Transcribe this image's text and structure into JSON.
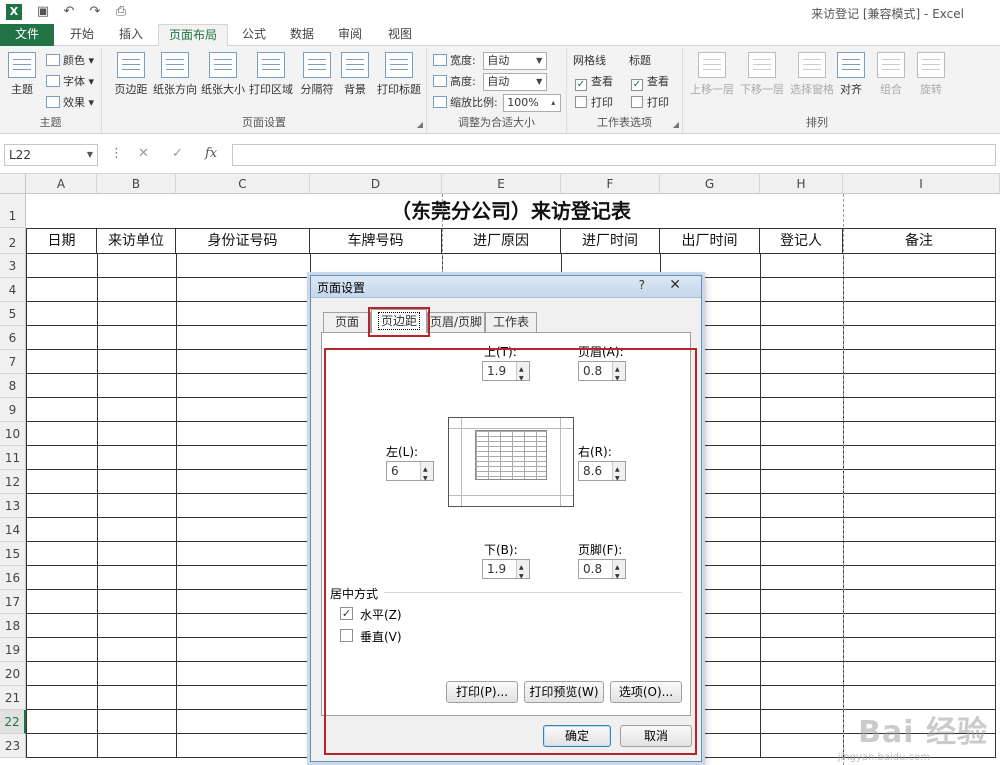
{
  "window": {
    "title": "来访登记 [兼容模式] - Excel",
    "app_icon": "X"
  },
  "qat_icons": [
    "save-icon",
    "undo-icon",
    "redo-icon",
    "print-preview-icon"
  ],
  "ribbon": {
    "tabs": [
      {
        "label": "文件",
        "kind": "file"
      },
      {
        "label": "开始"
      },
      {
        "label": "插入"
      },
      {
        "label": "页面布局",
        "kind": "active"
      },
      {
        "label": "公式"
      },
      {
        "label": "数据"
      },
      {
        "label": "审阅"
      },
      {
        "label": "视图"
      }
    ],
    "theme_group": {
      "big_label": "主题",
      "items": [
        "颜色",
        "字体",
        "效果"
      ],
      "label": "主题"
    },
    "page_setup_group": {
      "buttons": [
        "页边距",
        "纸张方向",
        "纸张大小",
        "打印区域",
        "分隔符",
        "背景",
        "打印标题"
      ],
      "label": "页面设置"
    },
    "scale_group": {
      "width_label": "宽度:",
      "width_value": "自动",
      "height_label": "高度:",
      "height_value": "自动",
      "scale_label": "缩放比例:",
      "scale_value": "100%",
      "label": "调整为合适大小"
    },
    "sheet_options_group": {
      "gridlines": "网格线",
      "headings": "标题",
      "view": "查看",
      "print": "打印",
      "label": "工作表选项"
    },
    "arrange_group": {
      "buttons": [
        "上移一层",
        "下移一层",
        "选择窗格",
        "对齐",
        "组合",
        "旋转"
      ],
      "label": "排列"
    }
  },
  "formula_bar": {
    "name_box": "L22",
    "cancel": "✕",
    "enter": "✓",
    "fx": "fx",
    "value": ""
  },
  "sheet": {
    "columns": [
      "A",
      "B",
      "C",
      "D",
      "E",
      "F",
      "G",
      "H",
      "I"
    ],
    "rows": [
      "1",
      "2",
      "3",
      "4",
      "5",
      "6",
      "7",
      "8",
      "9",
      "10",
      "11",
      "12",
      "13",
      "14",
      "15",
      "16",
      "17",
      "18",
      "19",
      "20",
      "21",
      "22",
      "23"
    ],
    "title": "（东莞分公司）来访登记表",
    "headers": [
      "日期",
      "来访单位",
      "身份证号码",
      "车牌号码",
      "进厂原因",
      "进厂时间",
      "出厂时间",
      "登记人",
      "备注"
    ],
    "selected_row": "22"
  },
  "dialog": {
    "title": "页面设置",
    "help": "?",
    "close": "✕",
    "tabs": [
      {
        "label": "页面"
      },
      {
        "label": "页边距",
        "active": true
      },
      {
        "label": "页眉/页脚"
      },
      {
        "label": "工作表"
      }
    ],
    "margins": {
      "top_label": "上(T):",
      "top_value": "1.9",
      "header_label": "页眉(A):",
      "header_value": "0.8",
      "left_label": "左(L):",
      "left_value": "6",
      "right_label": "右(R):",
      "right_value": "8.6",
      "bottom_label": "下(B):",
      "bottom_value": "1.9",
      "footer_label": "页脚(F):",
      "footer_value": "0.8"
    },
    "center": {
      "group_label": "居中方式",
      "horizontal_label": "水平(Z)",
      "horizontal_checked": true,
      "vertical_label": "垂直(V)",
      "vertical_checked": false
    },
    "buttons": {
      "print": "打印(P)...",
      "print_preview": "打印预览(W)",
      "options": "选项(O)...",
      "ok": "确定",
      "cancel": "取消"
    }
  },
  "watermark": {
    "main": "Bai 经验",
    "sub": "jingyan.baidu.com"
  }
}
